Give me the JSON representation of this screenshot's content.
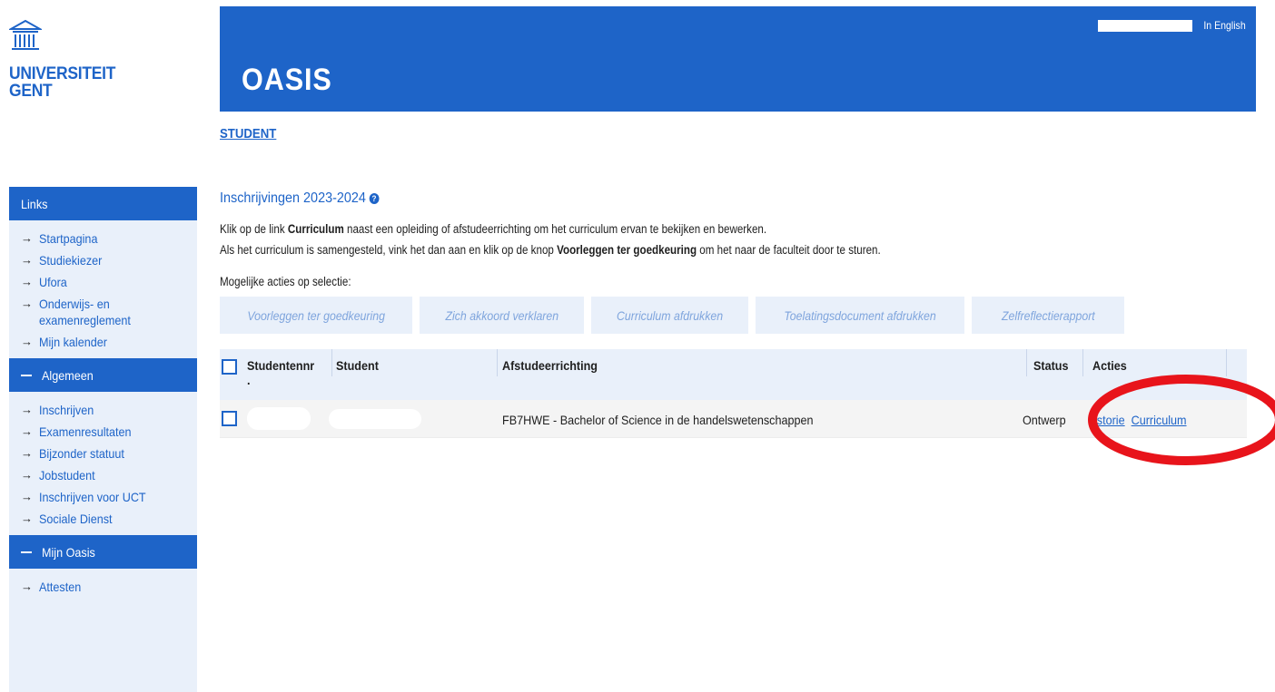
{
  "logo": {
    "line1": "UNIVERSITEIT",
    "line2": "GENT"
  },
  "banner": {
    "title": "OASIS",
    "lang_link": "In English"
  },
  "breadcrumb": "STUDENT",
  "sidebar": {
    "links_header": "Links",
    "links": [
      "Startpagina",
      "Studiekiezer",
      "Ufora",
      "Onderwijs- en examenreglement",
      "Mijn kalender"
    ],
    "algemeen_header": "Algemeen",
    "algemeen": [
      "Inschrijven",
      "Examenresultaten",
      "Bijzonder statuut",
      "Jobstudent",
      "Inschrijven voor UCT",
      "Sociale Dienst"
    ],
    "oasis_header": "Mijn Oasis",
    "oasis": [
      "Attesten"
    ]
  },
  "main": {
    "section_title": "Inschrijvingen 2023-2024",
    "instr1_a": "Klik op de link ",
    "instr1_b": "Curriculum",
    "instr1_c": " naast een opleiding of afstudeerrichting om het curriculum ervan te bekijken en bewerken.",
    "instr2_a": "Als het curriculum is samengesteld, vink het dan aan en klik op de knop ",
    "instr2_b": "Voorleggen ter goedkeuring",
    "instr2_c": " om het naar de faculteit door te sturen.",
    "actions_label": "Mogelijke acties op selectie:",
    "actions": [
      "Voorleggen ter goedkeuring",
      "Zich akkoord verklaren",
      "Curriculum afdrukken",
      "Toelatingsdocument afdrukken",
      "Zelfreflectierapport"
    ]
  },
  "table": {
    "headers": {
      "studentennr": "Studentennr",
      "studentennr_dot": ".",
      "student": "Student",
      "afstudeerrichting": "Afstudeerrichting",
      "status": "Status",
      "acties": "Acties"
    },
    "rows": [
      {
        "studentennr": "",
        "student": "",
        "afstudeerrichting": "FB7HWE - Bachelor of Science in de handelswetenschappen",
        "status": "Ontwerp",
        "action_historie": "istorie",
        "action_curriculum": "Curriculum"
      }
    ]
  },
  "colors": {
    "brand": "#1e64c8",
    "sidebar_bg": "#e9f0fa",
    "annotation": "#e8141b"
  }
}
